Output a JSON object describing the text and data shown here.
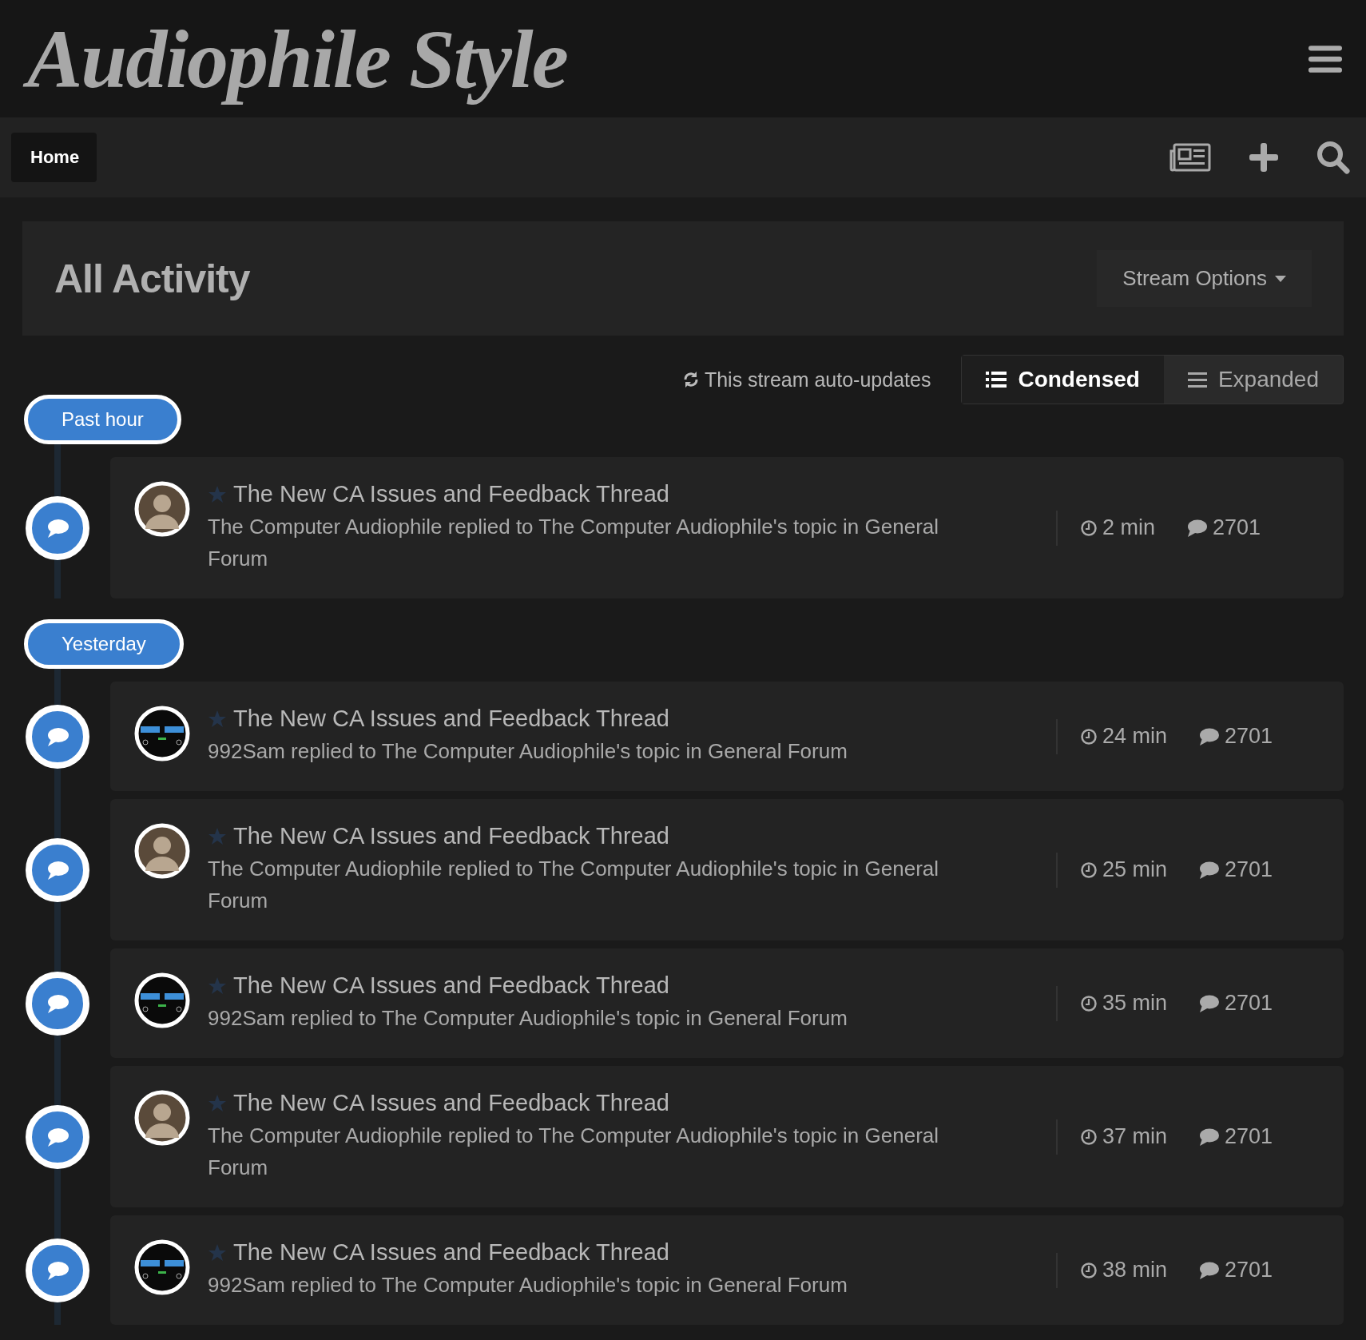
{
  "header": {
    "logo": "Audiophile Style"
  },
  "nav": {
    "breadcrumb": "Home"
  },
  "page": {
    "title": "All Activity",
    "options_button": "Stream Options"
  },
  "controls": {
    "auto_update": "This stream auto-updates",
    "views": [
      {
        "label": "Condensed",
        "selected": true
      },
      {
        "label": "Expanded",
        "selected": false
      }
    ]
  },
  "groups": [
    {
      "label": "Past hour",
      "items": [
        {
          "kind": "person",
          "title": "The New CA Issues and Feedback Thread",
          "summary": "The Computer Audiophile replied to The Computer Audiophile's topic in General Forum",
          "time": "2 min",
          "replies": "2701"
        }
      ]
    },
    {
      "label": "Yesterday",
      "items": [
        {
          "kind": "device",
          "title": "The New CA Issues and Feedback Thread",
          "summary": "992Sam replied to The Computer Audiophile's topic in General Forum",
          "time": "24 min",
          "replies": "2701"
        },
        {
          "kind": "person",
          "title": "The New CA Issues and Feedback Thread",
          "summary": "The Computer Audiophile replied to The Computer Audiophile's topic in General Forum",
          "time": "25 min",
          "replies": "2701"
        },
        {
          "kind": "device",
          "title": "The New CA Issues and Feedback Thread",
          "summary": "992Sam replied to The Computer Audiophile's topic in General Forum",
          "time": "35 min",
          "replies": "2701"
        },
        {
          "kind": "person",
          "title": "The New CA Issues and Feedback Thread",
          "summary": "The Computer Audiophile replied to The Computer Audiophile's topic in General Forum",
          "time": "37 min",
          "replies": "2701"
        },
        {
          "kind": "device",
          "title": "The New CA Issues and Feedback Thread",
          "summary": "992Sam replied to The Computer Audiophile's topic in General Forum",
          "time": "38 min",
          "replies": "2701"
        }
      ]
    }
  ]
}
